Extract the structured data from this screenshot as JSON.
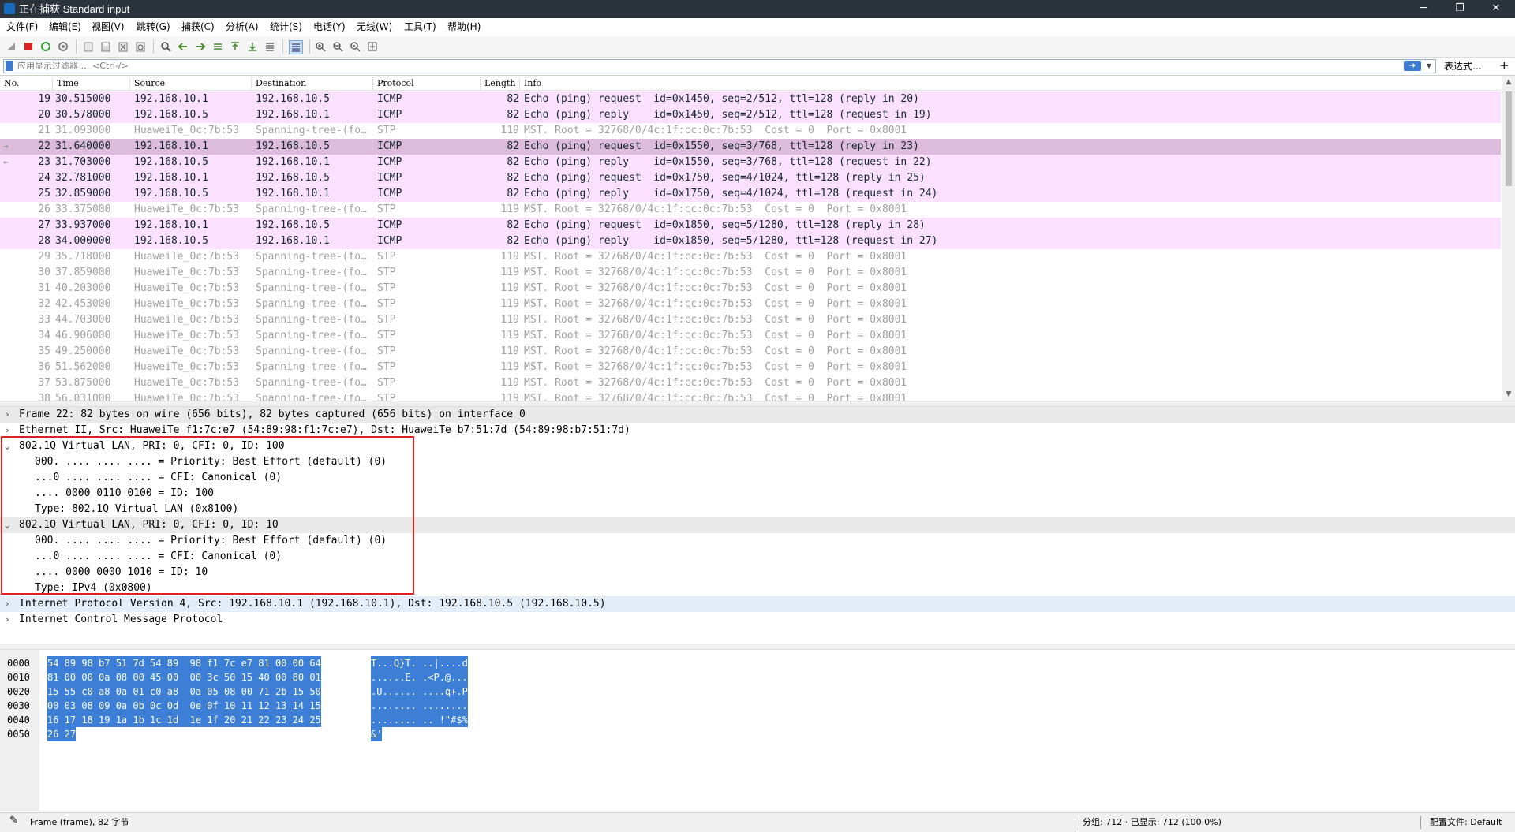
{
  "window": {
    "title": "正在捕获 Standard input",
    "controls": [
      "─",
      "❐",
      "✕"
    ]
  },
  "menu": [
    "文件(F)",
    "编辑(E)",
    "视图(V)",
    "跳转(G)",
    "捕获(C)",
    "分析(A)",
    "统计(S)",
    "电话(Y)",
    "无线(W)",
    "工具(T)",
    "帮助(H)"
  ],
  "filter": {
    "placeholder": "应用显示过滤器 … <Ctrl-/>",
    "expression_label": "表达式…",
    "add_label": "+"
  },
  "packet_list": {
    "columns": [
      "No.",
      "Time",
      "Source",
      "Destination",
      "Protocol",
      "Length",
      "Info"
    ],
    "rows": [
      {
        "no": "19",
        "time": "30.515000",
        "src": "192.168.10.1",
        "dst": "192.168.10.5",
        "proto": "ICMP",
        "len": "82",
        "info": "Echo (ping) request  id=0x1450, seq=2/512, ttl=128 (reply in 20)",
        "kind": "icmp"
      },
      {
        "no": "20",
        "time": "30.578000",
        "src": "192.168.10.5",
        "dst": "192.168.10.1",
        "proto": "ICMP",
        "len": "82",
        "info": "Echo (ping) reply    id=0x1450, seq=2/512, ttl=128 (request in 19)",
        "kind": "icmp"
      },
      {
        "no": "21",
        "time": "31.093000",
        "src": "HuaweiTe_0c:7b:53",
        "dst": "Spanning-tree-(fo…",
        "proto": "STP",
        "len": "119",
        "info": "MST. Root = 32768/0/4c:1f:cc:0c:7b:53  Cost = 0  Port = 0x8001",
        "kind": "stp"
      },
      {
        "no": "22",
        "time": "31.640000",
        "src": "192.168.10.1",
        "dst": "192.168.10.5",
        "proto": "ICMP",
        "len": "82",
        "info": "Echo (ping) request  id=0x1550, seq=3/768, ttl=128 (reply in 23)",
        "kind": "selected",
        "rel": "→"
      },
      {
        "no": "23",
        "time": "31.703000",
        "src": "192.168.10.5",
        "dst": "192.168.10.1",
        "proto": "ICMP",
        "len": "82",
        "info": "Echo (ping) reply    id=0x1550, seq=3/768, ttl=128 (request in 22)",
        "kind": "icmp",
        "rel": "←"
      },
      {
        "no": "24",
        "time": "32.781000",
        "src": "192.168.10.1",
        "dst": "192.168.10.5",
        "proto": "ICMP",
        "len": "82",
        "info": "Echo (ping) request  id=0x1750, seq=4/1024, ttl=128 (reply in 25)",
        "kind": "icmp"
      },
      {
        "no": "25",
        "time": "32.859000",
        "src": "192.168.10.5",
        "dst": "192.168.10.1",
        "proto": "ICMP",
        "len": "82",
        "info": "Echo (ping) reply    id=0x1750, seq=4/1024, ttl=128 (request in 24)",
        "kind": "icmp"
      },
      {
        "no": "26",
        "time": "33.375000",
        "src": "HuaweiTe_0c:7b:53",
        "dst": "Spanning-tree-(fo…",
        "proto": "STP",
        "len": "119",
        "info": "MST. Root = 32768/0/4c:1f:cc:0c:7b:53  Cost = 0  Port = 0x8001",
        "kind": "stp"
      },
      {
        "no": "27",
        "time": "33.937000",
        "src": "192.168.10.1",
        "dst": "192.168.10.5",
        "proto": "ICMP",
        "len": "82",
        "info": "Echo (ping) request  id=0x1850, seq=5/1280, ttl=128 (reply in 28)",
        "kind": "icmp"
      },
      {
        "no": "28",
        "time": "34.000000",
        "src": "192.168.10.5",
        "dst": "192.168.10.1",
        "proto": "ICMP",
        "len": "82",
        "info": "Echo (ping) reply    id=0x1850, seq=5/1280, ttl=128 (request in 27)",
        "kind": "icmp"
      },
      {
        "no": "29",
        "time": "35.718000",
        "src": "HuaweiTe_0c:7b:53",
        "dst": "Spanning-tree-(fo…",
        "proto": "STP",
        "len": "119",
        "info": "MST. Root = 32768/0/4c:1f:cc:0c:7b:53  Cost = 0  Port = 0x8001",
        "kind": "stp"
      },
      {
        "no": "30",
        "time": "37.859000",
        "src": "HuaweiTe_0c:7b:53",
        "dst": "Spanning-tree-(fo…",
        "proto": "STP",
        "len": "119",
        "info": "MST. Root = 32768/0/4c:1f:cc:0c:7b:53  Cost = 0  Port = 0x8001",
        "kind": "stp"
      },
      {
        "no": "31",
        "time": "40.203000",
        "src": "HuaweiTe_0c:7b:53",
        "dst": "Spanning-tree-(fo…",
        "proto": "STP",
        "len": "119",
        "info": "MST. Root = 32768/0/4c:1f:cc:0c:7b:53  Cost = 0  Port = 0x8001",
        "kind": "stp"
      },
      {
        "no": "32",
        "time": "42.453000",
        "src": "HuaweiTe_0c:7b:53",
        "dst": "Spanning-tree-(fo…",
        "proto": "STP",
        "len": "119",
        "info": "MST. Root = 32768/0/4c:1f:cc:0c:7b:53  Cost = 0  Port = 0x8001",
        "kind": "stp"
      },
      {
        "no": "33",
        "time": "44.703000",
        "src": "HuaweiTe_0c:7b:53",
        "dst": "Spanning-tree-(fo…",
        "proto": "STP",
        "len": "119",
        "info": "MST. Root = 32768/0/4c:1f:cc:0c:7b:53  Cost = 0  Port = 0x8001",
        "kind": "stp"
      },
      {
        "no": "34",
        "time": "46.906000",
        "src": "HuaweiTe_0c:7b:53",
        "dst": "Spanning-tree-(fo…",
        "proto": "STP",
        "len": "119",
        "info": "MST. Root = 32768/0/4c:1f:cc:0c:7b:53  Cost = 0  Port = 0x8001",
        "kind": "stp"
      },
      {
        "no": "35",
        "time": "49.250000",
        "src": "HuaweiTe_0c:7b:53",
        "dst": "Spanning-tree-(fo…",
        "proto": "STP",
        "len": "119",
        "info": "MST. Root = 32768/0/4c:1f:cc:0c:7b:53  Cost = 0  Port = 0x8001",
        "kind": "stp"
      },
      {
        "no": "36",
        "time": "51.562000",
        "src": "HuaweiTe_0c:7b:53",
        "dst": "Spanning-tree-(fo…",
        "proto": "STP",
        "len": "119",
        "info": "MST. Root = 32768/0/4c:1f:cc:0c:7b:53  Cost = 0  Port = 0x8001",
        "kind": "stp"
      },
      {
        "no": "37",
        "time": "53.875000",
        "src": "HuaweiTe_0c:7b:53",
        "dst": "Spanning-tree-(fo…",
        "proto": "STP",
        "len": "119",
        "info": "MST. Root = 32768/0/4c:1f:cc:0c:7b:53  Cost = 0  Port = 0x8001",
        "kind": "stp"
      },
      {
        "no": "38",
        "time": "56.031000",
        "src": "HuaweiTe_0c:7b:53",
        "dst": "Spanning-tree-(fo…",
        "proto": "STP",
        "len": "119",
        "info": "MST. Root = 32768/0/4c:1f:cc:0c:7b:53  Cost = 0  Port = 0x8001",
        "kind": "stp"
      }
    ]
  },
  "details": [
    {
      "arrow": ">",
      "text": "Frame 22: 82 bytes on wire (656 bits), 82 bytes captured (656 bits) on interface 0",
      "indent": 0,
      "style": "shade"
    },
    {
      "arrow": ">",
      "text": "Ethernet II, Src: HuaweiTe_f1:7c:e7 (54:89:98:f1:7c:e7), Dst: HuaweiTe_b7:51:7d (54:89:98:b7:51:7d)",
      "indent": 0,
      "style": ""
    },
    {
      "arrow": "v",
      "text": "802.1Q Virtual LAN, PRI: 0, CFI: 0, ID: 100",
      "indent": 0,
      "style": ""
    },
    {
      "arrow": "",
      "text": "000. .... .... .... = Priority: Best Effort (default) (0)",
      "indent": 1,
      "style": ""
    },
    {
      "arrow": "",
      "text": "...0 .... .... .... = CFI: Canonical (0)",
      "indent": 1,
      "style": ""
    },
    {
      "arrow": "",
      "text": ".... 0000 0110 0100 = ID: 100",
      "indent": 1,
      "style": ""
    },
    {
      "arrow": "",
      "text": "Type: 802.1Q Virtual LAN (0x8100)",
      "indent": 1,
      "style": ""
    },
    {
      "arrow": "v",
      "text": "802.1Q Virtual LAN, PRI: 0, CFI: 0, ID: 10",
      "indent": 0,
      "style": "shade"
    },
    {
      "arrow": "",
      "text": "000. .... .... .... = Priority: Best Effort (default) (0)",
      "indent": 1,
      "style": ""
    },
    {
      "arrow": "",
      "text": "...0 .... .... .... = CFI: Canonical (0)",
      "indent": 1,
      "style": ""
    },
    {
      "arrow": "",
      "text": ".... 0000 0000 1010 = ID: 10",
      "indent": 1,
      "style": ""
    },
    {
      "arrow": "",
      "text": "Type: IPv4 (0x0800)",
      "indent": 1,
      "style": ""
    },
    {
      "arrow": ">",
      "text": "Internet Protocol Version 4, Src: 192.168.10.1 (192.168.10.1), Dst: 192.168.10.5 (192.168.10.5)",
      "indent": 0,
      "style": "blue"
    },
    {
      "arrow": ">",
      "text": "Internet Control Message Protocol",
      "indent": 0,
      "style": ""
    }
  ],
  "bytes": [
    {
      "off": "0000",
      "hex": "54 89 98 b7 51 7d 54 89  98 f1 7c e7 81 00 00 64",
      "asc": "T...Q}T. ..|....d"
    },
    {
      "off": "0010",
      "hex": "81 00 00 0a 08 00 45 00  00 3c 50 15 40 00 80 01",
      "asc": "......E. .<P.@..."
    },
    {
      "off": "0020",
      "hex": "15 55 c0 a8 0a 01 c0 a8  0a 05 08 00 71 2b 15 50",
      "asc": ".U...... ....q+.P"
    },
    {
      "off": "0030",
      "hex": "00 03 08 09 0a 0b 0c 0d  0e 0f 10 11 12 13 14 15",
      "asc": "........ ........"
    },
    {
      "off": "0040",
      "hex": "16 17 18 19 1a 1b 1c 1d  1e 1f 20 21 22 23 24 25",
      "asc": "........ .. !\"#$%"
    },
    {
      "off": "0050",
      "hex": "26 27",
      "asc": "&'"
    }
  ],
  "status": {
    "left": "Frame (frame), 82 字节",
    "packets": "分组: 712 · 已显示: 712 (100.0%)",
    "profile": "配置文件: Default"
  },
  "colors": {
    "icmp_row": "#fce0ff",
    "selected_row": "#ddbbdd",
    "highlight_box": "#e02020",
    "byte_highlight": "#3d7fd6"
  }
}
